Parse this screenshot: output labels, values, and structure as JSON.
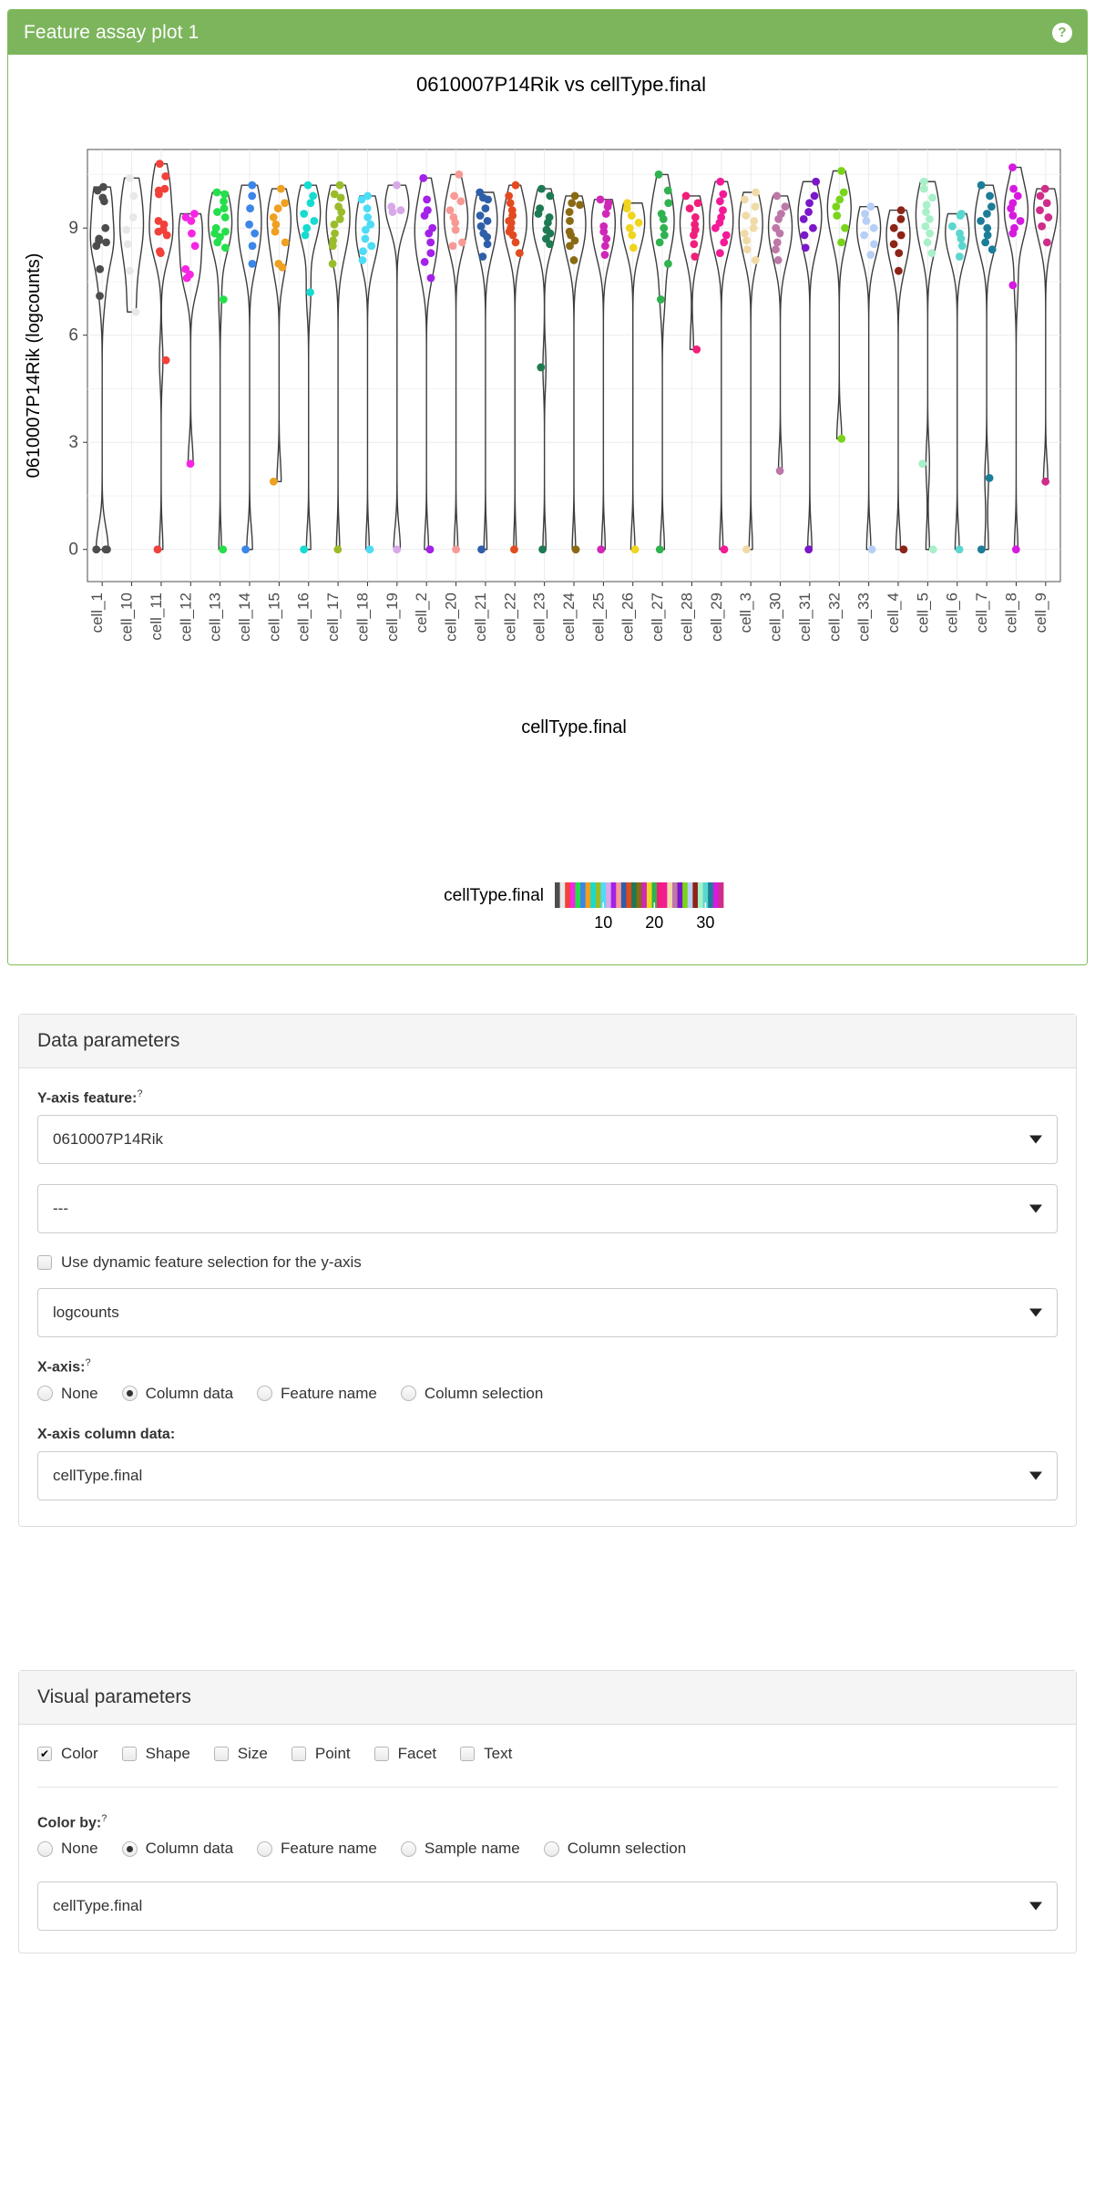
{
  "header": {
    "title": "Feature assay plot 1",
    "help_icon": "question-mark-icon",
    "bg_color": "#7cb55c"
  },
  "chart_data": {
    "type": "violin",
    "title": "0610007P14Rik vs cellType.final",
    "xlabel": "cellType.final",
    "ylabel": "0610007P14Rik (logcounts)",
    "ylim": [
      -0.9,
      11.2
    ],
    "yticks": [
      0,
      3,
      6,
      9
    ],
    "grid": true,
    "legend": {
      "title": "cellType.final",
      "position": "bottom",
      "type": "colorbar",
      "ticks": [
        10,
        20,
        30
      ]
    },
    "categories": [
      "cell_1",
      "cell_10",
      "cell_11",
      "cell_12",
      "cell_13",
      "cell_14",
      "cell_15",
      "cell_16",
      "cell_17",
      "cell_18",
      "cell_19",
      "cell_2",
      "cell_20",
      "cell_21",
      "cell_22",
      "cell_23",
      "cell_24",
      "cell_25",
      "cell_26",
      "cell_27",
      "cell_28",
      "cell_29",
      "cell_3",
      "cell_30",
      "cell_31",
      "cell_32",
      "cell_33",
      "cell_4",
      "cell_5",
      "cell_6",
      "cell_7",
      "cell_8",
      "cell_9"
    ],
    "colors": [
      "#4d4d4d",
      "#e8e8e8",
      "#f2403a",
      "#f725e4",
      "#23e04a",
      "#3b86e8",
      "#f0a020",
      "#16dbd1",
      "#9bbc2a",
      "#4ddcf5",
      "#d9a8e8",
      "#a321e8",
      "#f79a96",
      "#2f5fa8",
      "#e34a20",
      "#1d7a52",
      "#8a6a12",
      "#cf27b8",
      "#f0d51e",
      "#2fb24f",
      "#f01f7a",
      "#f21a97",
      "#f0dba8",
      "#bd77a8",
      "#7a18c9",
      "#7ad41a",
      "#b8cff5",
      "#8c2418",
      "#a8f0c8",
      "#5ad6cf",
      "#1c7d99",
      "#d61ae0",
      "#cf2d8a"
    ],
    "series": [
      {
        "category": "cell_1",
        "median": 9.0,
        "min": 0.0,
        "max": 10.2,
        "n": 14,
        "points": [
          10.15,
          10.05,
          9.85,
          9.75,
          9.0,
          8.7,
          8.65,
          8.6,
          8.5,
          7.85,
          7.1,
          0.0,
          0.0,
          0.0
        ]
      },
      {
        "category": "cell_10",
        "median": 9.2,
        "min": 6.6,
        "max": 10.4,
        "n": 7,
        "points": [
          10.4,
          9.9,
          9.3,
          8.95,
          8.55,
          7.8,
          6.65
        ]
      },
      {
        "category": "cell_11",
        "median": 9.0,
        "min": 0.0,
        "max": 10.8,
        "n": 14,
        "points": [
          10.8,
          10.45,
          10.1,
          10.05,
          9.95,
          9.2,
          9.1,
          8.95,
          8.9,
          8.8,
          8.35,
          8.3,
          5.3,
          0.0
        ]
      },
      {
        "category": "cell_12",
        "median": 8.6,
        "min": 0.0,
        "max": 9.4,
        "n": 9,
        "points": [
          9.4,
          9.3,
          9.2,
          8.85,
          8.5,
          7.85,
          7.7,
          7.6,
          2.4
        ]
      },
      {
        "category": "cell_13",
        "median": 9.2,
        "min": 0.0,
        "max": 10.0,
        "n": 14,
        "points": [
          10.0,
          9.95,
          9.75,
          9.55,
          9.45,
          9.3,
          9.0,
          8.9,
          8.85,
          8.75,
          8.6,
          8.45,
          7.0,
          0.0
        ]
      },
      {
        "category": "cell_14",
        "median": 9.1,
        "min": 0.0,
        "max": 10.2,
        "n": 8,
        "points": [
          10.2,
          9.9,
          9.55,
          9.1,
          8.85,
          8.5,
          8.0,
          0.0
        ]
      },
      {
        "category": "cell_15",
        "median": 9.0,
        "min": 0.0,
        "max": 10.1,
        "n": 10,
        "points": [
          10.1,
          9.7,
          9.55,
          9.3,
          9.1,
          8.9,
          8.6,
          8.0,
          7.9,
          1.9
        ]
      },
      {
        "category": "cell_16",
        "median": 9.0,
        "min": 0.0,
        "max": 10.2,
        "n": 9,
        "points": [
          10.2,
          9.9,
          9.7,
          9.4,
          9.2,
          9.0,
          8.8,
          7.2,
          0.0
        ]
      },
      {
        "category": "cell_17",
        "median": 9.2,
        "min": 0.0,
        "max": 10.2,
        "n": 12,
        "points": [
          10.2,
          9.95,
          9.85,
          9.6,
          9.45,
          9.25,
          9.1,
          8.85,
          8.65,
          8.5,
          8.0,
          0.0
        ]
      },
      {
        "category": "cell_18",
        "median": 8.9,
        "min": 0.0,
        "max": 9.9,
        "n": 11,
        "points": [
          9.9,
          9.8,
          9.55,
          9.3,
          9.1,
          8.95,
          8.7,
          8.5,
          8.35,
          8.1,
          0.0
        ]
      },
      {
        "category": "cell_19",
        "median": 9.3,
        "min": 0.0,
        "max": 10.2,
        "n": 5,
        "points": [
          10.2,
          9.6,
          9.5,
          9.45,
          0.0
        ]
      },
      {
        "category": "cell_2",
        "median": 9.0,
        "min": 0.0,
        "max": 10.4,
        "n": 11,
        "points": [
          10.4,
          9.8,
          9.5,
          9.35,
          9.0,
          8.85,
          8.6,
          8.3,
          8.05,
          7.6,
          0.0
        ]
      },
      {
        "category": "cell_20",
        "median": 9.2,
        "min": 0.0,
        "max": 10.5,
        "n": 10,
        "points": [
          10.5,
          9.9,
          9.75,
          9.5,
          9.3,
          9.15,
          8.95,
          8.6,
          8.5,
          0.0
        ]
      },
      {
        "category": "cell_21",
        "median": 9.0,
        "min": 0.0,
        "max": 10.0,
        "n": 12,
        "points": [
          10.0,
          9.85,
          9.8,
          9.55,
          9.35,
          9.2,
          9.05,
          8.85,
          8.75,
          8.55,
          8.2,
          0.0
        ]
      },
      {
        "category": "cell_22",
        "median": 9.1,
        "min": 0.0,
        "max": 10.2,
        "n": 13,
        "points": [
          10.2,
          9.9,
          9.7,
          9.5,
          9.35,
          9.2,
          9.15,
          9.0,
          8.9,
          8.8,
          8.6,
          8.3,
          0.0
        ]
      },
      {
        "category": "cell_23",
        "median": 9.1,
        "min": 0.0,
        "max": 10.1,
        "n": 12,
        "points": [
          10.1,
          9.9,
          9.55,
          9.4,
          9.3,
          9.15,
          8.95,
          8.85,
          8.7,
          8.55,
          5.1,
          0.0
        ]
      },
      {
        "category": "cell_24",
        "median": 8.9,
        "min": 0.0,
        "max": 9.9,
        "n": 11,
        "points": [
          9.9,
          9.7,
          9.65,
          9.45,
          9.2,
          8.9,
          8.8,
          8.65,
          8.5,
          8.1,
          0.0
        ]
      },
      {
        "category": "cell_25",
        "median": 8.9,
        "min": 0.0,
        "max": 9.8,
        "n": 10,
        "points": [
          9.8,
          9.7,
          9.6,
          9.4,
          9.05,
          8.9,
          8.7,
          8.5,
          8.25,
          0.0
        ]
      },
      {
        "category": "cell_26",
        "median": 9.1,
        "min": 0.0,
        "max": 9.7,
        "n": 8,
        "points": [
          9.7,
          9.55,
          9.35,
          9.15,
          9.0,
          8.8,
          8.45,
          0.0
        ]
      },
      {
        "category": "cell_27",
        "median": 9.0,
        "min": 0.0,
        "max": 10.5,
        "n": 11,
        "points": [
          10.5,
          10.05,
          9.7,
          9.4,
          9.25,
          9.0,
          8.8,
          8.6,
          8.0,
          7.0,
          0.0
        ]
      },
      {
        "category": "cell_28",
        "median": 9.0,
        "min": 0.0,
        "max": 9.9,
        "n": 10,
        "points": [
          9.9,
          9.7,
          9.55,
          9.3,
          9.1,
          8.95,
          8.8,
          8.55,
          8.2,
          5.6
        ]
      },
      {
        "category": "cell_29",
        "median": 9.1,
        "min": 0.0,
        "max": 10.3,
        "n": 11,
        "points": [
          10.3,
          9.95,
          9.75,
          9.5,
          9.3,
          9.15,
          9.0,
          8.8,
          8.6,
          8.3,
          0.0
        ]
      },
      {
        "category": "cell_3",
        "median": 9.0,
        "min": 0.0,
        "max": 10.0,
        "n": 11,
        "points": [
          10.0,
          9.8,
          9.6,
          9.35,
          9.2,
          9.0,
          8.85,
          8.65,
          8.4,
          8.1,
          0.0
        ]
      },
      {
        "category": "cell_30",
        "median": 9.0,
        "min": 0.0,
        "max": 9.9,
        "n": 10,
        "points": [
          9.9,
          9.6,
          9.4,
          9.25,
          9.0,
          8.85,
          8.6,
          8.4,
          8.1,
          2.2
        ]
      },
      {
        "category": "cell_31",
        "median": 9.2,
        "min": 0.0,
        "max": 10.3,
        "n": 9,
        "points": [
          10.3,
          9.9,
          9.7,
          9.45,
          9.25,
          9.0,
          8.8,
          8.45,
          0.0
        ]
      },
      {
        "category": "cell_32",
        "median": 9.3,
        "min": 0.0,
        "max": 10.6,
        "n": 8,
        "points": [
          10.6,
          10.0,
          9.8,
          9.6,
          9.35,
          9.0,
          8.6,
          3.1
        ]
      },
      {
        "category": "cell_33",
        "median": 8.8,
        "min": 0.0,
        "max": 9.6,
        "n": 8,
        "points": [
          9.6,
          9.4,
          9.2,
          9.0,
          8.8,
          8.55,
          8.25,
          0.0
        ]
      },
      {
        "category": "cell_4",
        "median": 8.7,
        "min": 0.0,
        "max": 9.5,
        "n": 8,
        "points": [
          9.5,
          9.25,
          9.0,
          8.8,
          8.55,
          8.3,
          7.8,
          0.0
        ]
      },
      {
        "category": "cell_5",
        "median": 9.0,
        "min": 0.0,
        "max": 10.3,
        "n": 12,
        "points": [
          10.3,
          10.1,
          9.85,
          9.65,
          9.45,
          9.25,
          9.05,
          8.85,
          8.6,
          8.3,
          2.4,
          0.0
        ]
      },
      {
        "category": "cell_6",
        "median": 8.8,
        "min": 0.0,
        "max": 9.4,
        "n": 8,
        "points": [
          9.4,
          9.35,
          9.05,
          8.85,
          8.7,
          8.5,
          8.2,
          0.0
        ]
      },
      {
        "category": "cell_7",
        "median": 9.1,
        "min": 0.0,
        "max": 10.2,
        "n": 11,
        "points": [
          10.2,
          9.9,
          9.6,
          9.4,
          9.2,
          9.0,
          8.8,
          8.6,
          8.4,
          2.0,
          0.0
        ]
      },
      {
        "category": "cell_8",
        "median": 9.3,
        "min": 0.0,
        "max": 10.7,
        "n": 11,
        "points": [
          10.7,
          10.1,
          9.9,
          9.7,
          9.55,
          9.35,
          9.2,
          9.0,
          8.85,
          7.4,
          0.0
        ]
      },
      {
        "category": "cell_9",
        "median": 9.2,
        "min": 1.9,
        "max": 10.1,
        "n": 8,
        "points": [
          10.1,
          9.9,
          9.7,
          9.5,
          9.3,
          9.05,
          8.6,
          1.9
        ]
      }
    ]
  },
  "data_parameters": {
    "heading": "Data parameters",
    "yaxis_feature_label": "Y-axis feature:",
    "yaxis_feature_help": "?",
    "yaxis_feature_value": "0610007P14Rik",
    "yaxis_secondary_value": "---",
    "dynamic_checkbox_label": "Use dynamic feature selection for the y-axis",
    "dynamic_checkbox_checked": false,
    "assay_value": "logcounts",
    "xaxis_label": "X-axis:",
    "xaxis_help": "?",
    "xaxis_options": [
      "None",
      "Column data",
      "Feature name",
      "Column selection"
    ],
    "xaxis_selected": "Column data",
    "xaxis_column_label": "X-axis column data:",
    "xaxis_column_value": "cellType.final"
  },
  "visual_parameters": {
    "heading": "Visual parameters",
    "toggles": [
      {
        "label": "Color",
        "checked": true
      },
      {
        "label": "Shape",
        "checked": false
      },
      {
        "label": "Size",
        "checked": false
      },
      {
        "label": "Point",
        "checked": false
      },
      {
        "label": "Facet",
        "checked": false
      },
      {
        "label": "Text",
        "checked": false
      }
    ],
    "color_by_label": "Color by:",
    "color_by_help": "?",
    "color_by_options": [
      "None",
      "Column data",
      "Feature name",
      "Sample name",
      "Column selection"
    ],
    "color_by_selected": "Column data",
    "color_by_value": "cellType.final"
  }
}
